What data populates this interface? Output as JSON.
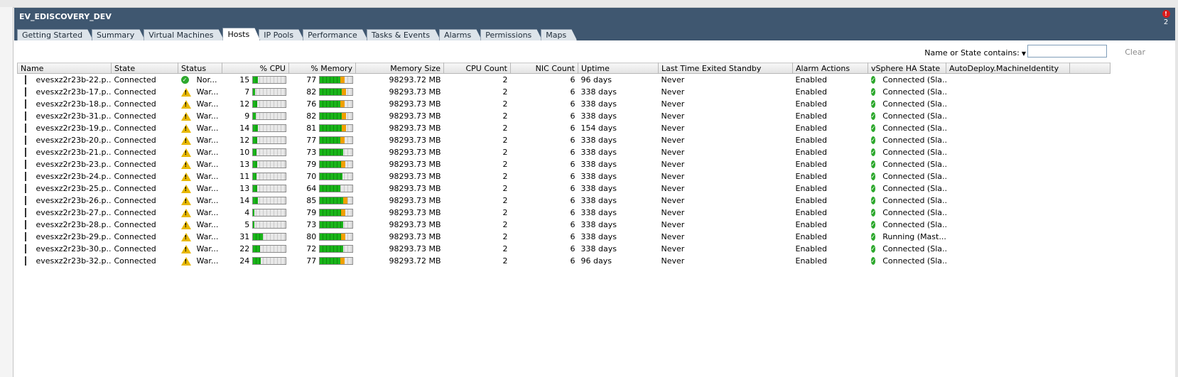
{
  "window": {
    "title": "EV_EDISCOVERY_DEV",
    "alarm_count": "2"
  },
  "tabs": [
    {
      "label": "Getting Started",
      "active": false
    },
    {
      "label": "Summary",
      "active": false
    },
    {
      "label": "Virtual Machines",
      "active": false
    },
    {
      "label": "Hosts",
      "active": true
    },
    {
      "label": "IP Pools",
      "active": false
    },
    {
      "label": "Performance",
      "active": false
    },
    {
      "label": "Tasks & Events",
      "active": false
    },
    {
      "label": "Alarms",
      "active": false
    },
    {
      "label": "Permissions",
      "active": false
    },
    {
      "label": "Maps",
      "active": false
    }
  ],
  "filter": {
    "label": "Name or State contains:",
    "value": "",
    "clear_label": "Clear"
  },
  "columns": [
    "Name",
    "State",
    "Status",
    "% CPU",
    "% Memory",
    "Memory Size",
    "CPU Count",
    "NIC Count",
    "Uptime",
    "Last Time Exited Standby",
    "Alarm Actions",
    "vSphere HA State",
    "AutoDeploy.MachineIdentity"
  ],
  "colors": {
    "header_bg": "#3f5770",
    "ok": "#2da82d",
    "warning": "#e8b800",
    "bar_green": "#19b519",
    "bar_high": "#f0a000"
  },
  "rows": [
    {
      "name": "evesxz2r23b-22.p...",
      "state": "Connected",
      "status": "Nor...",
      "status_icon": "ok-icon",
      "cpu": 15,
      "memory": 77,
      "memory_size": "98293.72 MB",
      "cpu_count": "2",
      "nic_count": "6",
      "uptime": "96 days",
      "last_standby": "Never",
      "alarm_actions": "Enabled",
      "ha_state": "Connected (Sla...",
      "autodeploy": ""
    },
    {
      "name": "evesxz2r23b-17.p...",
      "state": "Connected",
      "status": "War...",
      "status_icon": "warning-icon",
      "cpu": 7,
      "memory": 82,
      "memory_size": "98293.73 MB",
      "cpu_count": "2",
      "nic_count": "6",
      "uptime": "338 days",
      "last_standby": "Never",
      "alarm_actions": "Enabled",
      "ha_state": "Connected (Sla...",
      "autodeploy": ""
    },
    {
      "name": "evesxz2r23b-18.p...",
      "state": "Connected",
      "status": "War...",
      "status_icon": "warning-icon",
      "cpu": 12,
      "memory": 76,
      "memory_size": "98293.73 MB",
      "cpu_count": "2",
      "nic_count": "6",
      "uptime": "338 days",
      "last_standby": "Never",
      "alarm_actions": "Enabled",
      "ha_state": "Connected (Sla...",
      "autodeploy": ""
    },
    {
      "name": "evesxz2r23b-31.p...",
      "state": "Connected",
      "status": "War...",
      "status_icon": "warning-icon",
      "cpu": 9,
      "memory": 82,
      "memory_size": "98293.73 MB",
      "cpu_count": "2",
      "nic_count": "6",
      "uptime": "338 days",
      "last_standby": "Never",
      "alarm_actions": "Enabled",
      "ha_state": "Connected (Sla...",
      "autodeploy": ""
    },
    {
      "name": "evesxz2r23b-19.p...",
      "state": "Connected",
      "status": "War...",
      "status_icon": "warning-icon",
      "cpu": 14,
      "memory": 81,
      "memory_size": "98293.73 MB",
      "cpu_count": "2",
      "nic_count": "6",
      "uptime": "154 days",
      "last_standby": "Never",
      "alarm_actions": "Enabled",
      "ha_state": "Connected (Sla...",
      "autodeploy": ""
    },
    {
      "name": "evesxz2r23b-20.p...",
      "state": "Connected",
      "status": "War...",
      "status_icon": "warning-icon",
      "cpu": 12,
      "memory": 77,
      "memory_size": "98293.73 MB",
      "cpu_count": "2",
      "nic_count": "6",
      "uptime": "338 days",
      "last_standby": "Never",
      "alarm_actions": "Enabled",
      "ha_state": "Connected (Sla...",
      "autodeploy": ""
    },
    {
      "name": "evesxz2r23b-21.p...",
      "state": "Connected",
      "status": "War...",
      "status_icon": "warning-icon",
      "cpu": 10,
      "memory": 73,
      "memory_size": "98293.73 MB",
      "cpu_count": "2",
      "nic_count": "6",
      "uptime": "338 days",
      "last_standby": "Never",
      "alarm_actions": "Enabled",
      "ha_state": "Connected (Sla...",
      "autodeploy": ""
    },
    {
      "name": "evesxz2r23b-23.p...",
      "state": "Connected",
      "status": "War...",
      "status_icon": "warning-icon",
      "cpu": 13,
      "memory": 79,
      "memory_size": "98293.73 MB",
      "cpu_count": "2",
      "nic_count": "6",
      "uptime": "338 days",
      "last_standby": "Never",
      "alarm_actions": "Enabled",
      "ha_state": "Connected (Sla...",
      "autodeploy": ""
    },
    {
      "name": "evesxz2r23b-24.p...",
      "state": "Connected",
      "status": "War...",
      "status_icon": "warning-icon",
      "cpu": 11,
      "memory": 70,
      "memory_size": "98293.73 MB",
      "cpu_count": "2",
      "nic_count": "6",
      "uptime": "338 days",
      "last_standby": "Never",
      "alarm_actions": "Enabled",
      "ha_state": "Connected (Sla...",
      "autodeploy": ""
    },
    {
      "name": "evesxz2r23b-25.p...",
      "state": "Connected",
      "status": "War...",
      "status_icon": "warning-icon",
      "cpu": 13,
      "memory": 64,
      "memory_size": "98293.73 MB",
      "cpu_count": "2",
      "nic_count": "6",
      "uptime": "338 days",
      "last_standby": "Never",
      "alarm_actions": "Enabled",
      "ha_state": "Connected (Sla...",
      "autodeploy": ""
    },
    {
      "name": "evesxz2r23b-26.p...",
      "state": "Connected",
      "status": "War...",
      "status_icon": "warning-icon",
      "cpu": 14,
      "memory": 85,
      "memory_size": "98293.73 MB",
      "cpu_count": "2",
      "nic_count": "6",
      "uptime": "338 days",
      "last_standby": "Never",
      "alarm_actions": "Enabled",
      "ha_state": "Connected (Sla...",
      "autodeploy": ""
    },
    {
      "name": "evesxz2r23b-27.p...",
      "state": "Connected",
      "status": "War...",
      "status_icon": "warning-icon",
      "cpu": 4,
      "memory": 79,
      "memory_size": "98293.73 MB",
      "cpu_count": "2",
      "nic_count": "6",
      "uptime": "338 days",
      "last_standby": "Never",
      "alarm_actions": "Enabled",
      "ha_state": "Connected (Sla...",
      "autodeploy": ""
    },
    {
      "name": "evesxz2r23b-28.p...",
      "state": "Connected",
      "status": "War...",
      "status_icon": "warning-icon",
      "cpu": 5,
      "memory": 73,
      "memory_size": "98293.73 MB",
      "cpu_count": "2",
      "nic_count": "6",
      "uptime": "338 days",
      "last_standby": "Never",
      "alarm_actions": "Enabled",
      "ha_state": "Connected (Sla...",
      "autodeploy": ""
    },
    {
      "name": "evesxz2r23b-29.p...",
      "state": "Connected",
      "status": "War...",
      "status_icon": "warning-icon",
      "cpu": 31,
      "memory": 80,
      "memory_size": "98293.73 MB",
      "cpu_count": "2",
      "nic_count": "6",
      "uptime": "338 days",
      "last_standby": "Never",
      "alarm_actions": "Enabled",
      "ha_state": "Running (Mast...",
      "autodeploy": ""
    },
    {
      "name": "evesxz2r23b-30.p...",
      "state": "Connected",
      "status": "War...",
      "status_icon": "warning-icon",
      "cpu": 22,
      "memory": 72,
      "memory_size": "98293.73 MB",
      "cpu_count": "2",
      "nic_count": "6",
      "uptime": "338 days",
      "last_standby": "Never",
      "alarm_actions": "Enabled",
      "ha_state": "Connected (Sla...",
      "autodeploy": ""
    },
    {
      "name": "evesxz2r23b-32.p...",
      "state": "Connected",
      "status": "War...",
      "status_icon": "warning-icon",
      "cpu": 24,
      "memory": 77,
      "memory_size": "98293.72 MB",
      "cpu_count": "2",
      "nic_count": "6",
      "uptime": "96 days",
      "last_standby": "Never",
      "alarm_actions": "Enabled",
      "ha_state": "Connected (Sla...",
      "autodeploy": ""
    }
  ]
}
